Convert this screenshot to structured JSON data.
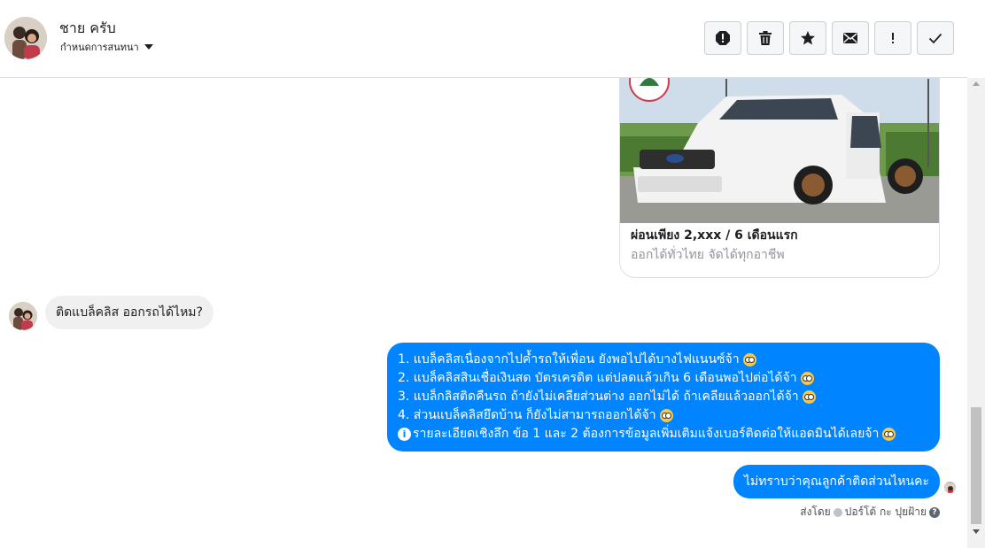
{
  "header": {
    "contact_name": "ชาย ครับ",
    "assign_label": "กำหนดการสนทนา",
    "toolbar": [
      {
        "name": "report-spam-button",
        "icon": "alert-octagon-icon"
      },
      {
        "name": "delete-button",
        "icon": "trash-icon"
      },
      {
        "name": "star-button",
        "icon": "star-icon"
      },
      {
        "name": "mark-unread-button",
        "icon": "envelope-icon"
      },
      {
        "name": "follow-up-button",
        "icon": "exclamation-icon"
      },
      {
        "name": "mark-done-button",
        "icon": "checkmark-icon"
      }
    ]
  },
  "ad": {
    "title": "ผ่อนเพียง 2,xxx / 6 เดือนแรก",
    "subtitle": "ออกได้ทั่วไทย จัดได้ทุกอาชีพ"
  },
  "messages": {
    "incoming_1": "ติดแบล็คลิส ออกรถได้ไหม?",
    "outgoing_lines": [
      "1. แบล็คลิสเนื่องจากไปค้ำรถให้เพื่อน ยังพอไปได้บางไฟแนนซ์จ้า",
      "2. แบล็คลิสสินเชื่อเงินสด บัตรเครดิต แต่ปลดแล้วเกิน 6 เดือนพอไปต่อได้จ้า",
      "3. แบล็กลิสติดคืนรถ ถ้ายังไม่เคลียส่วนต่าง ออกไม่ได้ ถ้าเคลียแล้วออกได้จ้า",
      "4. ส่วนแบล็คลิสยึดบ้าน ก็ยังไม่สามารถออกได้จ้า",
      "รายละเอียดเชิงลึก ข้อ 1 และ 2 ต้องการข้อมูลเพิ่มเติมแจ้งเบอร์ติดต่อให้แอดมินได้เลยจ้า"
    ],
    "outgoing_2": "ไม่ทราบว่าคุณลูกค้าติดส่วนไหนคะ",
    "sent_by_prefix": "ส่งโดย",
    "sent_by_name": "ปอร์โต้ กะ ปุยฝ้าย"
  },
  "colors": {
    "outgoing_bubble": "#0084ff",
    "incoming_bubble": "#f1f0f0"
  }
}
